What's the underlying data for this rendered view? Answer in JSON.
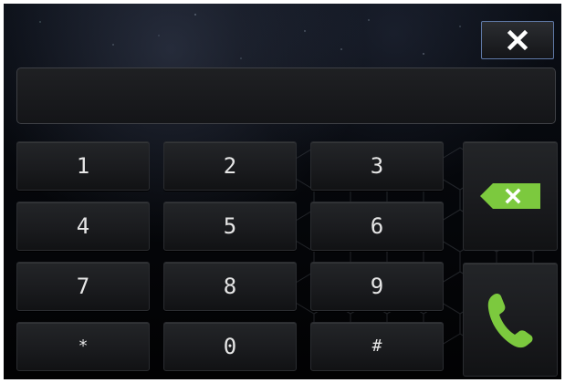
{
  "dialpad": {
    "display_value": "",
    "keys": [
      "1",
      "2",
      "3",
      "4",
      "5",
      "6",
      "7",
      "8",
      "9",
      "*",
      "0",
      "#"
    ]
  },
  "icons": {
    "close": "close-icon",
    "backspace": "backspace-icon",
    "call": "phone-call-icon"
  },
  "colors": {
    "accent_green": "#7cc93e",
    "close_border": "#5f79a6",
    "key_text": "#e6e6e6"
  }
}
